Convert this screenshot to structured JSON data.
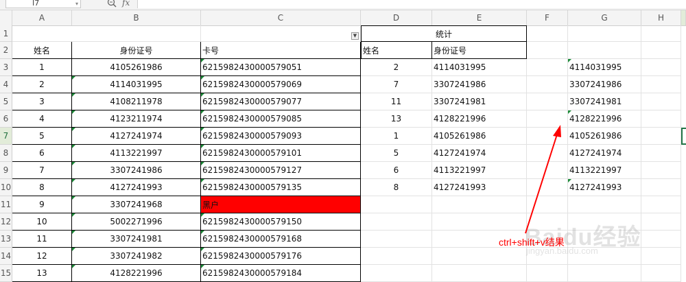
{
  "formula_bar": {
    "name_box": "I7",
    "fx": "fx"
  },
  "columns": [
    "A",
    "B",
    "C",
    "D",
    "E",
    "F",
    "G",
    "H"
  ],
  "rows": [
    "1",
    "2",
    "3",
    "4",
    "5",
    "6",
    "7",
    "8",
    "9",
    "10",
    "11",
    "12",
    "13",
    "14",
    "15"
  ],
  "sheet": {
    "header_tongji": "统计",
    "left_headers": {
      "name": "姓名",
      "id": "身份证号",
      "card": "卡号"
    },
    "right_headers": {
      "name": "姓名",
      "id": "身份证号"
    },
    "left_table": [
      {
        "name": "1",
        "id": "4105261986",
        "card": "6215982430000579051"
      },
      {
        "name": "2",
        "id": "4114031995",
        "card": "6215982430000579069"
      },
      {
        "name": "3",
        "id": "4108211978",
        "card": "6215982430000579077"
      },
      {
        "name": "4",
        "id": "4123211974",
        "card": "6215982430000579085"
      },
      {
        "name": "5",
        "id": "4127241974",
        "card": "6215982430000579093"
      },
      {
        "name": "6",
        "id": "4113221997",
        "card": "6215982430000579101"
      },
      {
        "name": "7",
        "id": "3307241986",
        "card": "6215982430000579127"
      },
      {
        "name": "8",
        "id": "4127241993",
        "card": "6215982430000579135"
      },
      {
        "name": "9",
        "id": "3307241968",
        "card": "黑户"
      },
      {
        "name": "10",
        "id": "5002271996",
        "card": "6215982430000579150"
      },
      {
        "name": "11",
        "id": "3307241981",
        "card": "6215982430000579168"
      },
      {
        "name": "12",
        "id": "3307241982",
        "card": "6215982430000579176"
      },
      {
        "name": "13",
        "id": "4128221996",
        "card": "6215982430000579184"
      }
    ],
    "right_table": [
      {
        "name": "2",
        "id": "4114031995"
      },
      {
        "name": "7",
        "id": "3307241986"
      },
      {
        "name": "11",
        "id": "3307241981"
      },
      {
        "name": "13",
        "id": "4128221996"
      },
      {
        "name": "1",
        "id": "4105261986"
      },
      {
        "name": "5",
        "id": "4127241974"
      },
      {
        "name": "6",
        "id": "4113221997"
      },
      {
        "name": "8",
        "id": "4127241993"
      }
    ],
    "g_column": [
      "4114031995",
      "3307241986",
      "3307241981",
      "4128221996",
      "4105261986",
      "4127241974",
      "4113221997",
      "4127241993"
    ]
  },
  "annotation": {
    "text": "ctrl+shift+v结果",
    "color": "#ff0000"
  },
  "watermark": {
    "main": "Baidu经验",
    "sub": "jingyan.baidu.com"
  },
  "colors": {
    "accent_green": "#217346",
    "red_fill": "#ff0000"
  }
}
